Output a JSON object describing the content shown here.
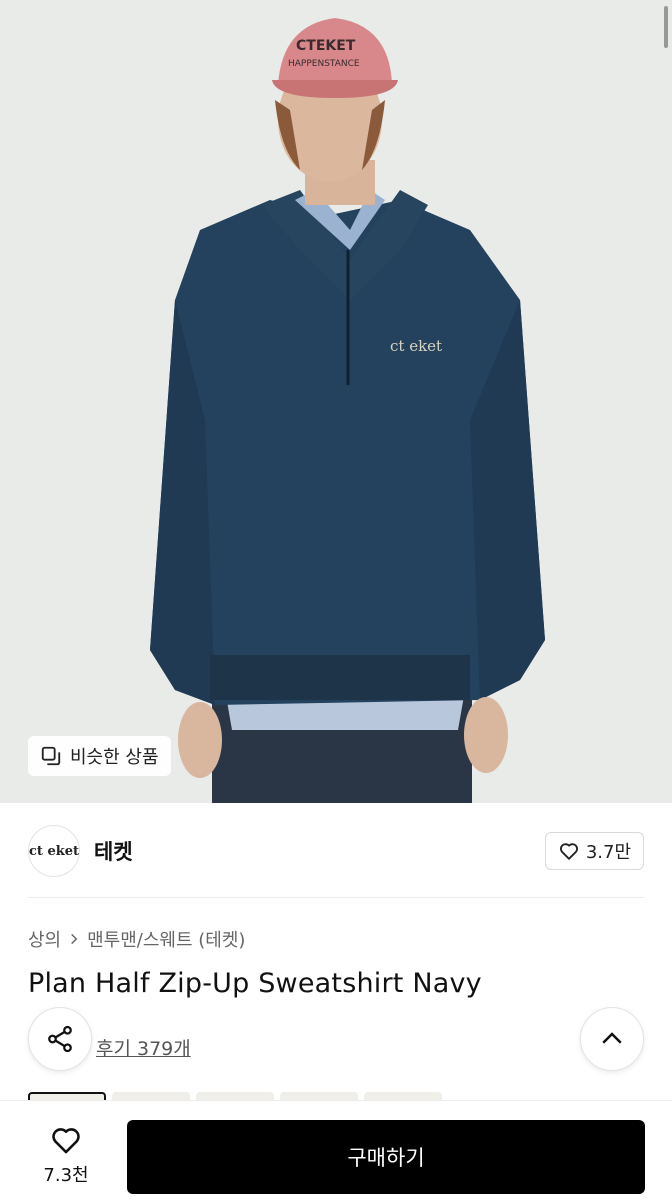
{
  "hero": {
    "similar_label": "비슷한 상품",
    "image_alt": "Model wearing navy half zip-up sweatshirt",
    "chest_logo": "ct eket"
  },
  "brand": {
    "logo_text": "ct eket",
    "name": "테켓",
    "likes": "3.7만"
  },
  "breadcrumb": {
    "category": "상의",
    "subcategory": "맨투맨/스웨트 (테켓)"
  },
  "product": {
    "title": "Plan Half Zip-Up Sweatshirt Navy",
    "reviews": "후기 379개"
  },
  "bottom_bar": {
    "wish_count": "7.3천",
    "buy_label": "구매하기"
  }
}
